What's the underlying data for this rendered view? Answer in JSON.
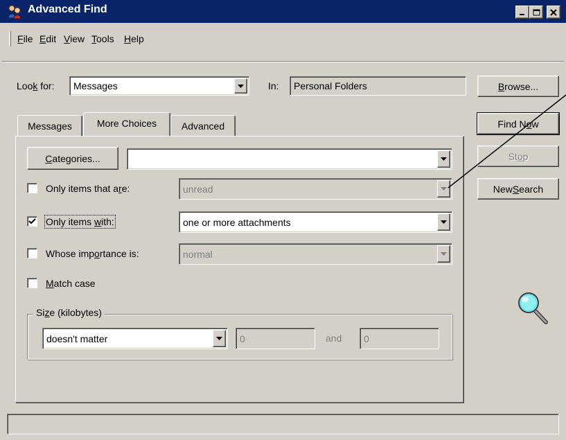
{
  "window": {
    "title": "Advanced Find",
    "controls": {
      "minimize": "_",
      "maximize": "□",
      "close": "×"
    }
  },
  "menu": [
    {
      "label": "File",
      "mnemonic": "F",
      "rest": "ile"
    },
    {
      "label": "Edit",
      "mnemonic": "E",
      "rest": "dit"
    },
    {
      "label": "View",
      "mnemonic": "V",
      "rest": "iew"
    },
    {
      "label": "Tools",
      "mnemonic": "T",
      "rest": "ools"
    },
    {
      "label": "Help",
      "mnemonic": "H",
      "rest": "elp"
    }
  ],
  "search": {
    "look_for_label_a": "Loo",
    "look_for_label_k": "k",
    "look_for_label_b": " for:",
    "look_for_value": "Messages",
    "in_label": "In:",
    "in_value": "Personal Folders",
    "browse_button": {
      "pre": "",
      "mn": "B",
      "post": "rowse..."
    }
  },
  "actions": {
    "find_now": {
      "pre": "Find N",
      "mn": "o",
      "post": "w"
    },
    "stop": {
      "pre": "St",
      "mn": "o",
      "post": "p",
      "enabled": false
    },
    "new_search": {
      "pre": "New ",
      "mn": "S",
      "post": "earch"
    }
  },
  "tabs": [
    {
      "label": "Messages",
      "active": false
    },
    {
      "label": "More Choices",
      "active": true
    },
    {
      "label": "Advanced",
      "active": false
    }
  ],
  "more_choices": {
    "categories_button": {
      "pre": "",
      "mn": "C",
      "post": "ategories..."
    },
    "categories_value": "",
    "only_items_that_are": {
      "pre": "Only items that a",
      "mn": "r",
      "post": "e:",
      "checked": false,
      "value": "unread",
      "enabled": false
    },
    "only_items_with": {
      "pre": "Only items ",
      "mn": "w",
      "post": "ith:",
      "checked": true,
      "value": "one or more attachments",
      "enabled": true
    },
    "whose_importance": {
      "pre": "Whose imp",
      "mn": "o",
      "post": "rtance is:",
      "checked": false,
      "value": "normal",
      "enabled": false
    },
    "match_case": {
      "pre": "",
      "mn": "M",
      "post": "atch case",
      "checked": false
    },
    "size_group": {
      "legend_pre": "Si",
      "legend_mn": "z",
      "legend_post": "e (kilobytes)",
      "condition": "doesn't matter",
      "from": "0",
      "and_label": "and",
      "to": "0"
    }
  },
  "colors": {
    "title_bar": "#0a246a",
    "face": "#d4d0c8",
    "shadow": "#808080",
    "highlight": "#ffffff"
  },
  "icons": {
    "app": "advanced-find-icon",
    "search_animation": "magnifier-icon",
    "checkmark": "checkmark-icon",
    "dropdown_arrow": "chevron-down-icon"
  }
}
